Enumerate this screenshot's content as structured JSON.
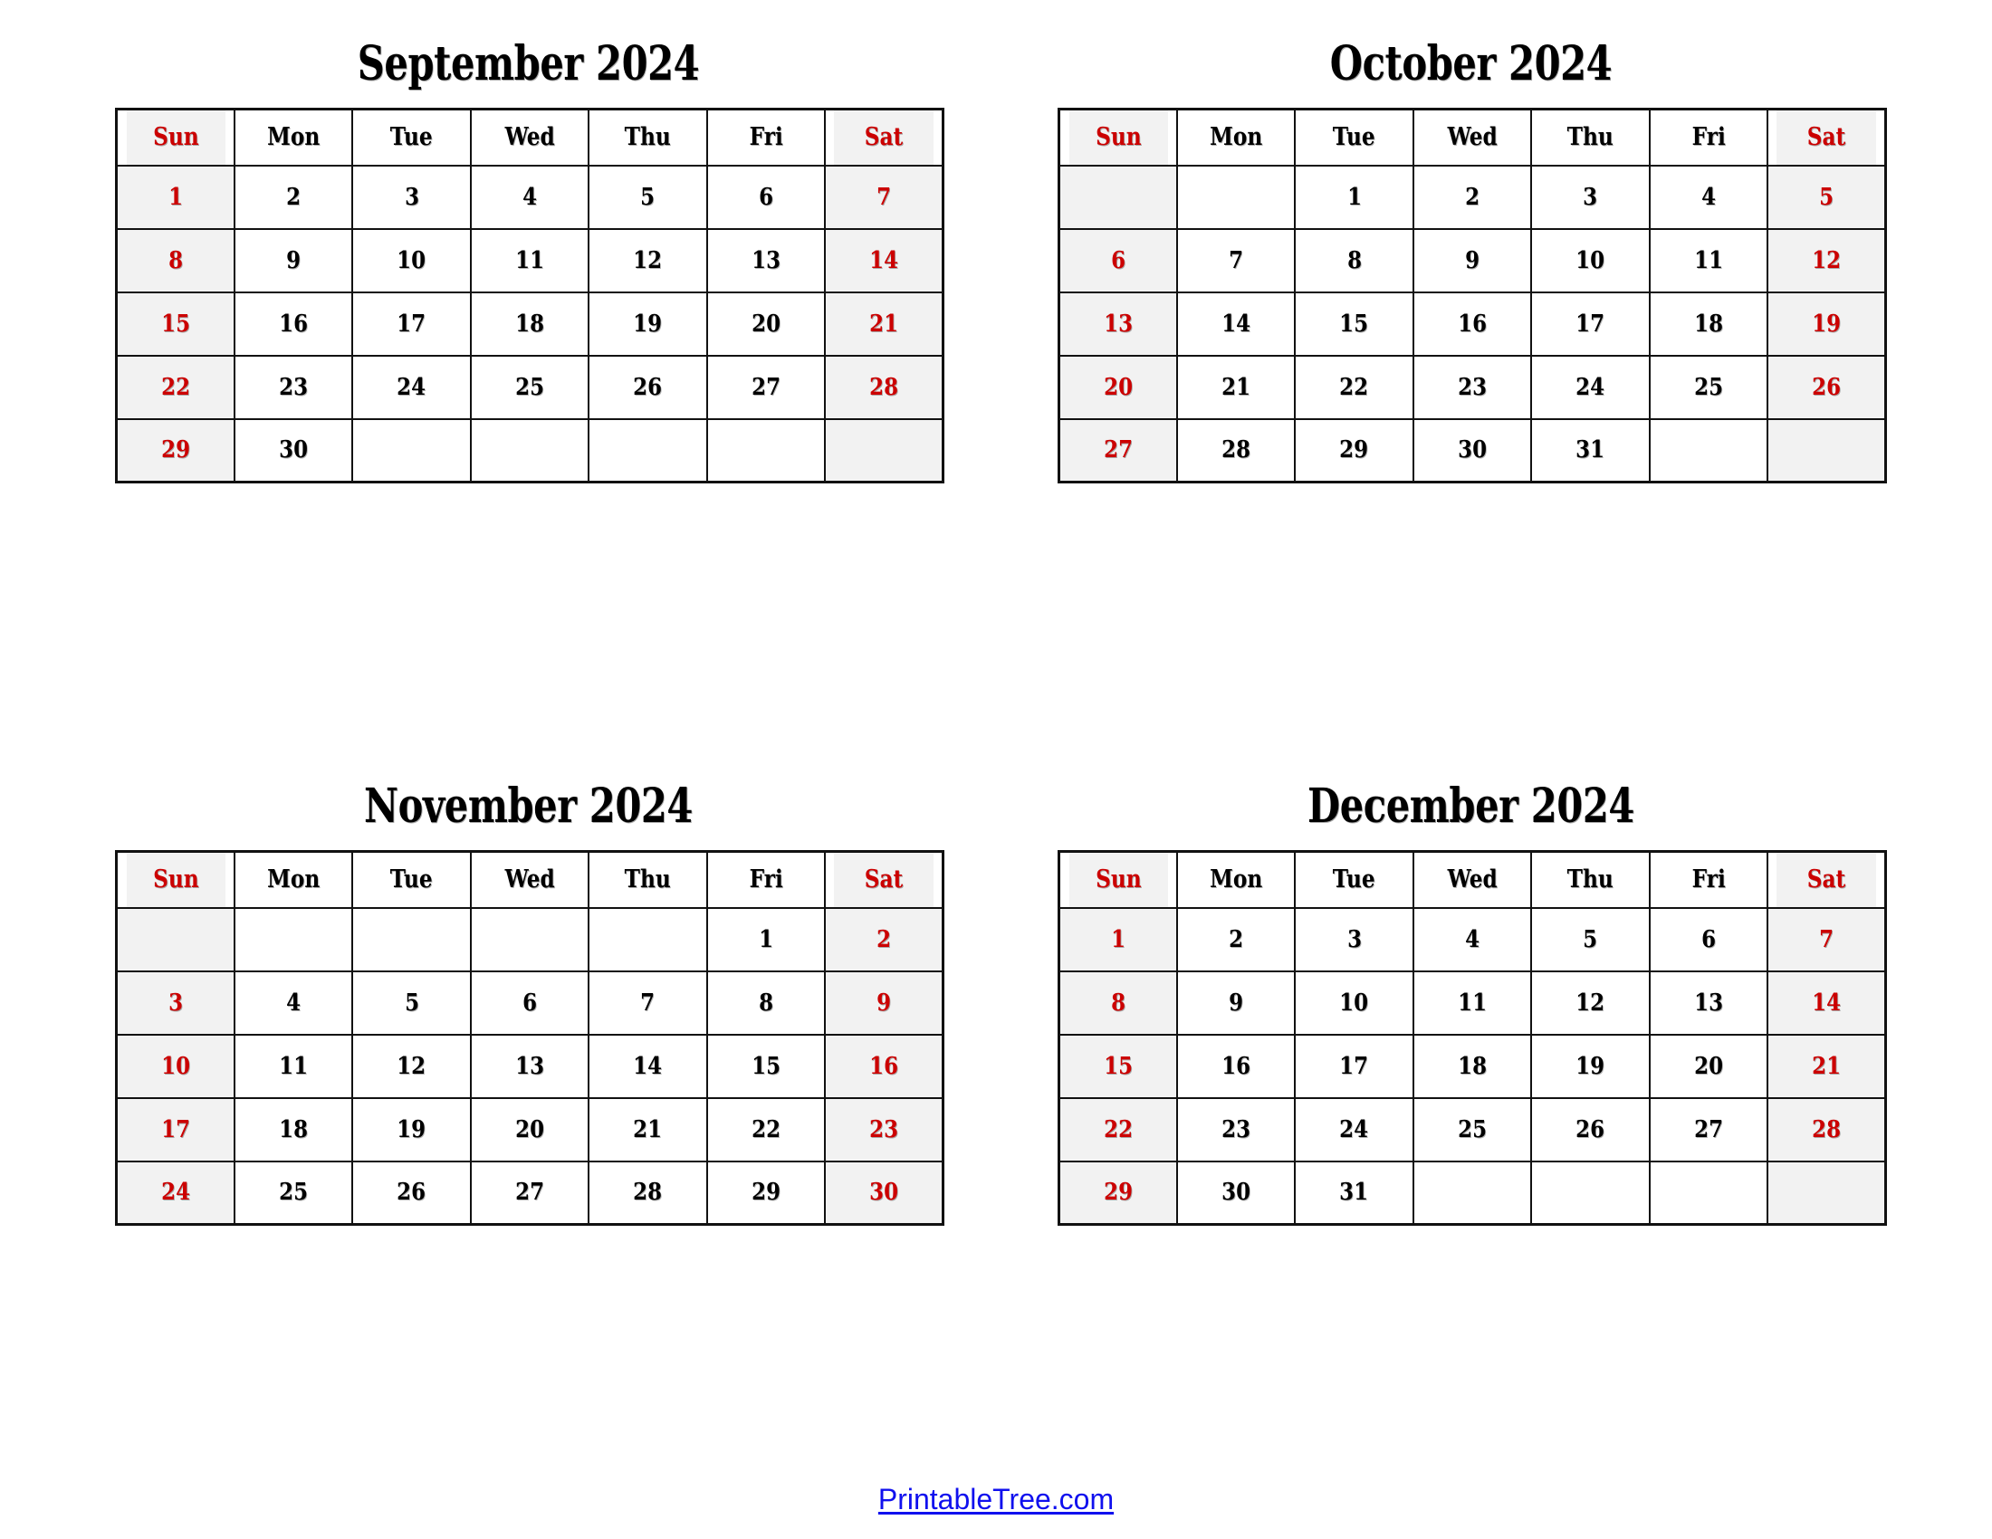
{
  "page": {
    "background_color": "#ffffff",
    "weekend_text_color": "#cc0000",
    "weekday_text_color": "#000000",
    "weekend_cell_color": "#f2f2f2",
    "border_color": "#111111",
    "link_color": "#1010ee"
  },
  "weekday_headers": [
    "Sun",
    "Mon",
    "Tue",
    "Wed",
    "Thu",
    "Fri",
    "Sat"
  ],
  "calendars": [
    {
      "id": "september",
      "title": "September 2024",
      "month": "September",
      "year": "2024",
      "weeks": [
        [
          "1",
          "2",
          "3",
          "4",
          "5",
          "6",
          "7"
        ],
        [
          "8",
          "9",
          "10",
          "11",
          "12",
          "13",
          "14"
        ],
        [
          "15",
          "16",
          "17",
          "18",
          "19",
          "20",
          "21"
        ],
        [
          "22",
          "23",
          "24",
          "25",
          "26",
          "27",
          "28"
        ],
        [
          "29",
          "30",
          "",
          "",
          "",
          "",
          ""
        ]
      ]
    },
    {
      "id": "october",
      "title": "October 2024",
      "month": "October",
      "year": "2024",
      "weeks": [
        [
          "",
          "",
          "1",
          "2",
          "3",
          "4",
          "5"
        ],
        [
          "6",
          "7",
          "8",
          "9",
          "10",
          "11",
          "12"
        ],
        [
          "13",
          "14",
          "15",
          "16",
          "17",
          "18",
          "19"
        ],
        [
          "20",
          "21",
          "22",
          "23",
          "24",
          "25",
          "26"
        ],
        [
          "27",
          "28",
          "29",
          "30",
          "31",
          "",
          ""
        ]
      ]
    },
    {
      "id": "november",
      "title": "November 2024",
      "month": "November",
      "year": "2024",
      "weeks": [
        [
          "",
          "",
          "",
          "",
          "",
          "1",
          "2"
        ],
        [
          "3",
          "4",
          "5",
          "6",
          "7",
          "8",
          "9"
        ],
        [
          "10",
          "11",
          "12",
          "13",
          "14",
          "15",
          "16"
        ],
        [
          "17",
          "18",
          "19",
          "20",
          "21",
          "22",
          "23"
        ],
        [
          "24",
          "25",
          "26",
          "27",
          "28",
          "29",
          "30"
        ]
      ]
    },
    {
      "id": "december",
      "title": "December 2024",
      "month": "December",
      "year": "2024",
      "weeks": [
        [
          "1",
          "2",
          "3",
          "4",
          "5",
          "6",
          "7"
        ],
        [
          "8",
          "9",
          "10",
          "11",
          "12",
          "13",
          "14"
        ],
        [
          "15",
          "16",
          "17",
          "18",
          "19",
          "20",
          "21"
        ],
        [
          "22",
          "23",
          "24",
          "25",
          "26",
          "27",
          "28"
        ],
        [
          "29",
          "30",
          "31",
          "",
          "",
          "",
          ""
        ]
      ]
    }
  ],
  "footer": {
    "link_label": "PrintableTree.com"
  }
}
